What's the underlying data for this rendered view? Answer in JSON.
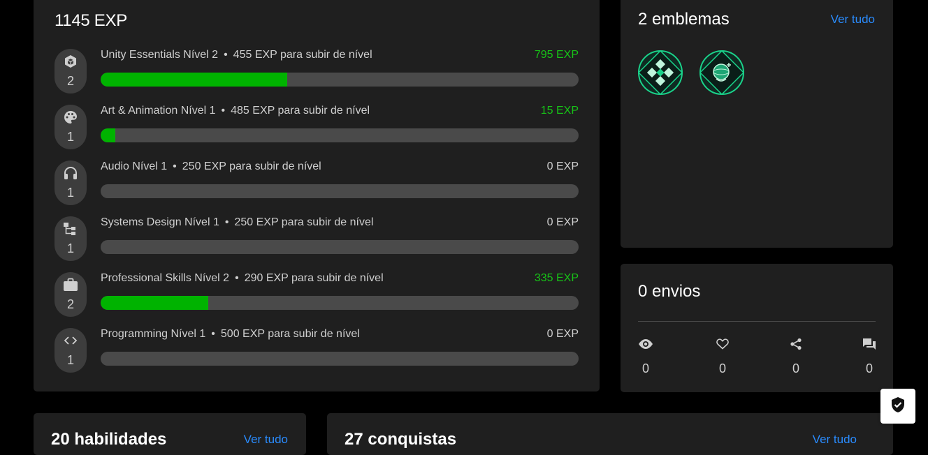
{
  "exp_card": {
    "total": "1145 EXP",
    "skills": [
      {
        "name": "Unity Essentials Nível 2",
        "sep": "•",
        "to_next": "455 EXP para subir de nível",
        "exp": "795 EXP",
        "level": "2",
        "icon": "unity-cube-icon",
        "progress": 0.39,
        "exp_color": "#17c317"
      },
      {
        "name": "Art & Animation Nível 1",
        "sep": "•",
        "to_next": "485 EXP para subir de nível",
        "exp": "15 EXP",
        "level": "1",
        "icon": "palette-icon",
        "progress": 0.03,
        "exp_color": "#17c317"
      },
      {
        "name": "Audio Nível 1",
        "sep": "•",
        "to_next": "250 EXP para subir de nível",
        "exp": "0 EXP",
        "level": "1",
        "icon": "headphones-icon",
        "progress": 0.0,
        "exp_color": "#cfcfcf"
      },
      {
        "name": "Systems Design Nível 1",
        "sep": "•",
        "to_next": "250 EXP para subir de nível",
        "exp": "0 EXP",
        "level": "1",
        "icon": "hierarchy-icon",
        "progress": 0.0,
        "exp_color": "#cfcfcf"
      },
      {
        "name": "Professional Skills Nível 2",
        "sep": "•",
        "to_next": "290 EXP para subir de nível",
        "exp": "335 EXP",
        "level": "2",
        "icon": "briefcase-icon",
        "progress": 0.225,
        "exp_color": "#17c317"
      },
      {
        "name": "Programming Nível 1",
        "sep": "•",
        "to_next": "500 EXP para subir de nível",
        "exp": "0 EXP",
        "level": "1",
        "icon": "code-icon",
        "progress": 0.0,
        "exp_color": "#cfcfcf"
      }
    ]
  },
  "emblems_card": {
    "title": "2 emblemas",
    "link": "Ver tudo",
    "emblems": [
      {
        "icon": "emblem-diamond-grid-icon"
      },
      {
        "icon": "emblem-globe-icon"
      }
    ]
  },
  "submissions_card": {
    "title": "0 envios",
    "stats": [
      {
        "icon": "eye-icon",
        "value": "0"
      },
      {
        "icon": "heart-icon",
        "value": "0"
      },
      {
        "icon": "share-icon",
        "value": "0"
      },
      {
        "icon": "comments-icon",
        "value": "0"
      }
    ]
  },
  "skills_card": {
    "title": "20 habilidades",
    "link": "Ver tudo"
  },
  "achievements_card": {
    "title": "27 conquistas",
    "link": "Ver tudo"
  },
  "colors": {
    "accent_green": "#00b300",
    "link_blue": "#2a8cff",
    "card_bg": "#1f1f1f"
  }
}
